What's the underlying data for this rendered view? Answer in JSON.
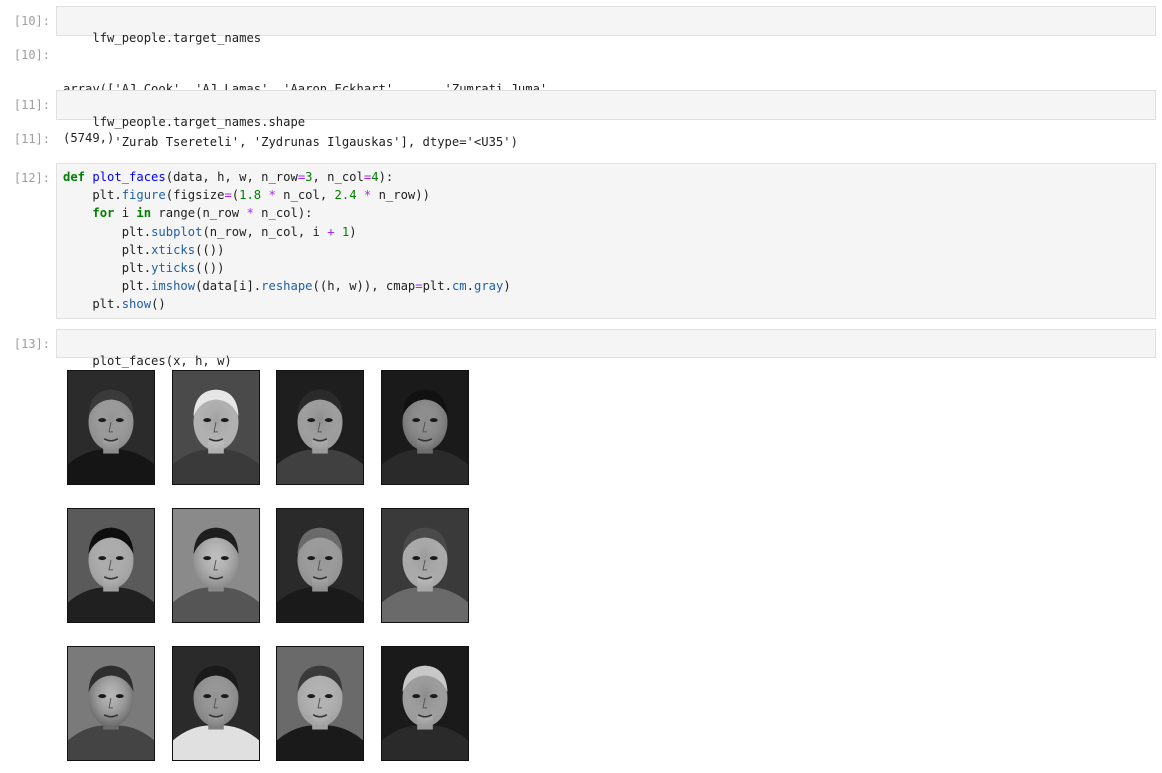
{
  "cells": {
    "c10": {
      "in_prompt": "[10]:",
      "code": "lfw_people.target_names",
      "out_prompt": "[10]:",
      "output_line1": "array(['AJ Cook', 'AJ Lamas', 'Aaron Eckhart', ..., 'Zumrati Juma',",
      "output_line2": "       'Zurab Tsereteli', 'Zydrunas Ilgauskas'], dtype='<U35')"
    },
    "c11": {
      "in_prompt": "[11]:",
      "code": "lfw_people.target_names.shape",
      "out_prompt": "[11]:",
      "output": "(5749,)"
    },
    "c12": {
      "in_prompt": "[12]:",
      "lines": [
        "def plot_faces(data, h, w, n_row=3, n_col=4):",
        "    plt.figure(figsize=(1.8 * n_col, 2.4 * n_row))",
        "    for i in range(n_row * n_col):",
        "        plt.subplot(n_row, n_col, i + 1)",
        "        plt.xticks(())",
        "        plt.yticks(())",
        "        plt.imshow(data[i].reshape((h, w)), cmap=plt.cm.gray)",
        "    plt.show()"
      ]
    },
    "c13": {
      "in_prompt": "[13]:",
      "code": "plot_faces(x, h, w)"
    }
  },
  "faces": [
    {
      "bg": "#2b2b2b",
      "skin": "#8c8c8c",
      "hair": "#3a3a3a",
      "shirt": "#151515"
    },
    {
      "bg": "#4a4a4a",
      "skin": "#b0b0b0",
      "hair": "#e6e6e6",
      "shirt": "#3a3a3a"
    },
    {
      "bg": "#1e1e1e",
      "skin": "#9a9a9a",
      "hair": "#2a2a2a",
      "shirt": "#404040"
    },
    {
      "bg": "#1a1a1a",
      "skin": "#6e6e6e",
      "hair": "#111111",
      "shirt": "#2a2a2a"
    },
    {
      "bg": "#5a5a5a",
      "skin": "#9e9e9e",
      "hair": "#0e0e0e",
      "shirt": "#202020"
    },
    {
      "bg": "#8a8a8a",
      "skin": "#8a8a8a",
      "hair": "#1e1e1e",
      "shirt": "#555555"
    },
    {
      "bg": "#2a2a2a",
      "skin": "#909090",
      "hair": "#6a6a6a",
      "shirt": "#1a1a1a"
    },
    {
      "bg": "#3a3a3a",
      "skin": "#a8a8a8",
      "hair": "#4a4a4a",
      "shirt": "#6a6a6a"
    },
    {
      "bg": "#7a7a7a",
      "skin": "#6a6a6a",
      "hair": "#2e2e2e",
      "shirt": "#444444"
    },
    {
      "bg": "#2a2a2a",
      "skin": "#808080",
      "hair": "#1a1a1a",
      "shirt": "#e0e0e0"
    },
    {
      "bg": "#6a6a6a",
      "skin": "#a0a0a0",
      "hair": "#3a3a3a",
      "shirt": "#1a1a1a"
    },
    {
      "bg": "#1a1a1a",
      "skin": "#9a9a9a",
      "hair": "#c8c8c8",
      "shirt": "#2a2a2a"
    }
  ]
}
